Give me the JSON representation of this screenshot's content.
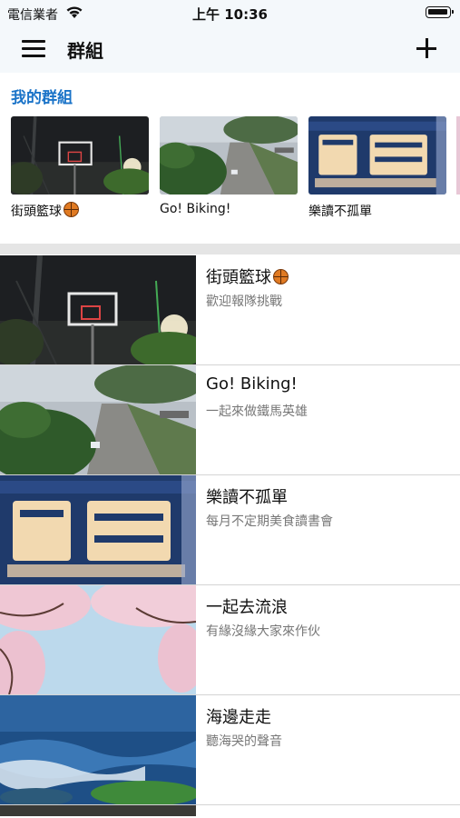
{
  "status_bar": {
    "carrier": "電信業者",
    "time": "上午 10:36"
  },
  "nav": {
    "title": "群組",
    "menu_icon": "hamburger-menu-icon",
    "add_icon": "plus-icon"
  },
  "my_groups": {
    "title": "我的群組",
    "cards": [
      {
        "name": "街頭籃球",
        "emoji_icon": "basketball-icon"
      },
      {
        "name": "Go! Biking!"
      },
      {
        "name": "樂讀不孤單"
      }
    ]
  },
  "groups": [
    {
      "name": "街頭籃球",
      "emoji_icon": "basketball-icon",
      "desc": "歡迎報隊挑戰"
    },
    {
      "name": "Go! Biking!",
      "desc": "一起來做鐵馬英雄"
    },
    {
      "name": "樂讀不孤單",
      "desc": "每月不定期美食讀書會"
    },
    {
      "name": "一起去流浪",
      "desc": "有緣沒緣大家來作伙"
    },
    {
      "name": "海邊走走",
      "desc": "聽海哭的聲音"
    }
  ],
  "colors": {
    "accent": "#1a73c8",
    "bar_background": "#f4f8fb",
    "separator": "#e5e5e5",
    "description_text": "#777777"
  }
}
